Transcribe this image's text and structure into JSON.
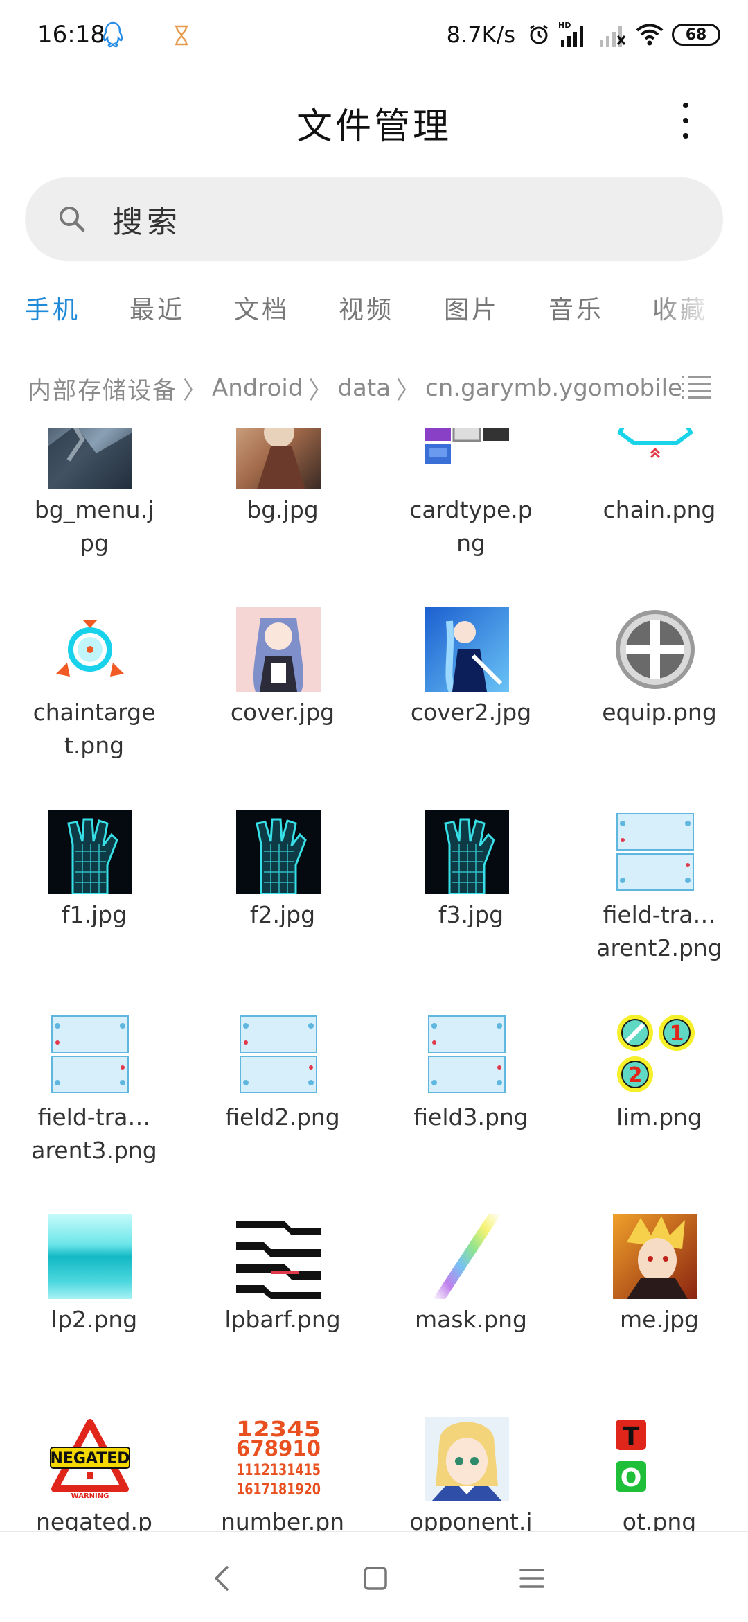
{
  "status_bar": {
    "time": "16:18",
    "net_speed": "8.7K/s",
    "battery": "68",
    "icons": [
      "qq-icon",
      "hourglass-icon",
      "alarm-icon",
      "signal-hd-icon",
      "signal-empty-icon",
      "wifi-icon",
      "battery-icon"
    ]
  },
  "header": {
    "title": "文件管理",
    "search_placeholder": "搜索"
  },
  "tabs": [
    "手机",
    "最近",
    "文档",
    "视频",
    "图片",
    "音乐",
    "收藏"
  ],
  "active_tab": "手机",
  "breadcrumb": [
    "内部存储设备",
    "Android",
    "data",
    "cn.garymb.ygomobile"
  ],
  "files": [
    {
      "name": "bg_menu.j\npg",
      "thumb": "bg-menu"
    },
    {
      "name": "bg.jpg",
      "thumb": "bg"
    },
    {
      "name": "cardtype.p\nng",
      "thumb": "cardtype"
    },
    {
      "name": "chain.png",
      "thumb": "chain"
    },
    {
      "name": "chaintarge\nt.png",
      "thumb": "chaintarget"
    },
    {
      "name": "cover.jpg",
      "thumb": "cover"
    },
    {
      "name": "cover2.jpg",
      "thumb": "cover2"
    },
    {
      "name": "equip.png",
      "thumb": "equip"
    },
    {
      "name": "f1.jpg",
      "thumb": "hand"
    },
    {
      "name": "f2.jpg",
      "thumb": "hand"
    },
    {
      "name": "f3.jpg",
      "thumb": "hand"
    },
    {
      "name": "field-tra…\narent2.png",
      "thumb": "field"
    },
    {
      "name": "field-tra…\narent3.png",
      "thumb": "field"
    },
    {
      "name": "field2.png",
      "thumb": "field"
    },
    {
      "name": "field3.png",
      "thumb": "field"
    },
    {
      "name": "lim.png",
      "thumb": "lim"
    },
    {
      "name": "lp2.png",
      "thumb": "lp2"
    },
    {
      "name": "lpbarf.png",
      "thumb": "lpbarf"
    },
    {
      "name": "mask.png",
      "thumb": "mask"
    },
    {
      "name": "me.jpg",
      "thumb": "me"
    },
    {
      "name": "negated.p",
      "thumb": "negated"
    },
    {
      "name": "number.pn",
      "thumb": "number"
    },
    {
      "name": "opponent.j",
      "thumb": "opponent"
    },
    {
      "name": "ot.png",
      "thumb": "ot"
    }
  ],
  "thumb_text": {
    "negated": "NEGATED",
    "warning": "WARNING",
    "number_rows": [
      "12345",
      "678910",
      "1112131415",
      "1617181920"
    ],
    "lim_1": "1",
    "lim_2": "2",
    "ot_top": "T",
    "ot_bottom": "O"
  },
  "colors": {
    "accent": "#1f8ad8",
    "tab_inactive": "#777777",
    "breadcrumb": "#8a8a8a",
    "search_bg": "#eeeeee"
  },
  "nav": [
    "back-icon",
    "home-icon",
    "menu-icon"
  ]
}
